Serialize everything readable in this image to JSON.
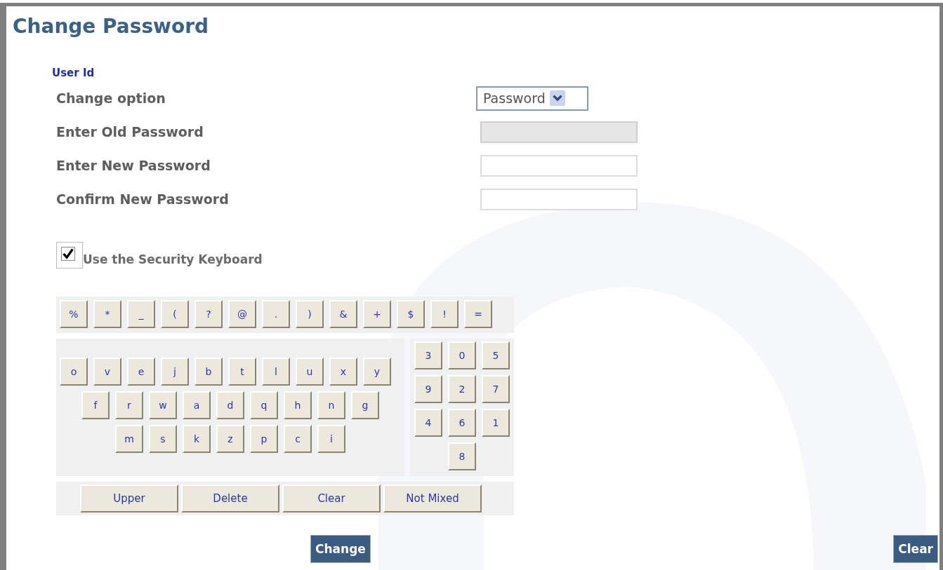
{
  "title": "Change Password",
  "user_id_label": "User Id",
  "fields": [
    {
      "label": "Change option",
      "kind": "select",
      "value": "Password"
    },
    {
      "label": "Enter Old Password",
      "kind": "text",
      "disabled": true
    },
    {
      "label": "Enter New Password",
      "kind": "text",
      "disabled": false
    },
    {
      "label": "Confirm New Password",
      "kind": "text",
      "disabled": false
    }
  ],
  "security_keyboard": {
    "label": "Use the Security Keyboard",
    "checked": true
  },
  "keyboard": {
    "symbols": [
      "%",
      "*",
      "_",
      "(",
      "?",
      "@",
      ".",
      ")",
      "&",
      "+",
      "$",
      "!",
      "="
    ],
    "letter_rows": [
      [
        "o",
        "v",
        "e",
        "j",
        "b",
        "t",
        "l",
        "u",
        "x",
        "y"
      ],
      [
        "f",
        "r",
        "w",
        "a",
        "d",
        "q",
        "h",
        "n",
        "g"
      ],
      [
        "m",
        "s",
        "k",
        "z",
        "p",
        "c",
        "i"
      ]
    ],
    "digit_rows": [
      [
        "3",
        "0",
        "5"
      ],
      [
        "9",
        "2",
        "7"
      ],
      [
        "4",
        "6",
        "1"
      ],
      [
        "8"
      ]
    ],
    "function_keys": [
      "Upper",
      "Delete",
      "Clear",
      "Not Mixed"
    ]
  },
  "buttons": {
    "change": "Change",
    "clear": "Clear"
  }
}
